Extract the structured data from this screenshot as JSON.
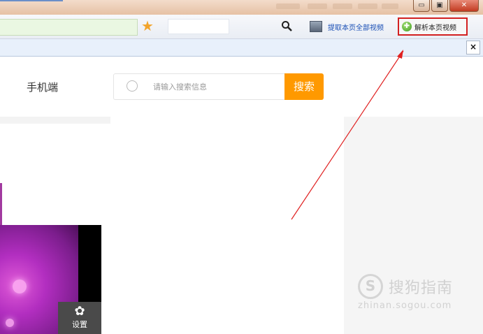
{
  "browser": {
    "window_buttons": {
      "minimize": "▭",
      "restore": "▣",
      "close": "✕"
    },
    "toolbar": {
      "extract_all_label": "提取本页全部视频",
      "parse_label": "解析本页视频",
      "parse_icon_glyph": "✚"
    },
    "infobar": {
      "close_glyph": "×"
    },
    "icons": [
      "star-icon",
      "search-icon",
      "video-list-icon",
      "parse-video-icon"
    ]
  },
  "page": {
    "mobile_link": "手机端",
    "search": {
      "placeholder": "请输入搜索信息",
      "button_label": "搜索"
    },
    "settings": {
      "icon_glyph": "✿",
      "label": "设置"
    }
  },
  "watermark": {
    "logo_glyph": "S",
    "name": "搜狗指南",
    "url": "zhinan.sogou.com"
  },
  "colors": {
    "accent_orange": "#ff9900",
    "highlight_red": "#d32020",
    "link_blue": "#1a4fb5"
  }
}
